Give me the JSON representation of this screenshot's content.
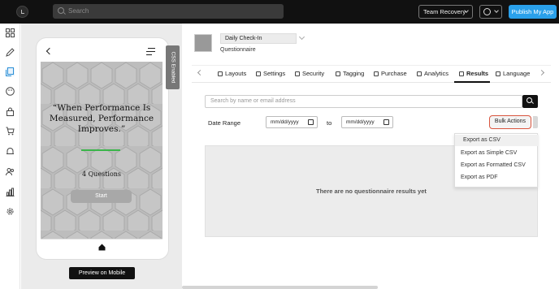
{
  "topbar": {
    "search_placeholder": "Search",
    "team_label": "Team Recovery",
    "publish_label": "Publish My App",
    "colors": {
      "bar": "#111111",
      "publish": "#2aa0ea"
    }
  },
  "leftnav": {
    "icons": [
      "grid-icon",
      "pencil-icon",
      "pages-icon",
      "palette-icon",
      "lock-icon",
      "cart-icon",
      "bell-icon",
      "users-icon",
      "chart-icon",
      "gear-icon"
    ],
    "active": "pages-icon"
  },
  "preview": {
    "css_tab_label": "CSS Enabled",
    "hero_title": "“When Performance Is Measured, Performance Improves.”",
    "question_count": "4 Questions",
    "start_label": "Start",
    "preview_button": "Preview on Mobile",
    "accent_line_color": "#3ab54a"
  },
  "header": {
    "app_name": "Daily Check-In",
    "app_type": "Questionnaire"
  },
  "tabs": {
    "items": [
      {
        "label": "Layouts",
        "icon": "layout-icon"
      },
      {
        "label": "Settings",
        "icon": "settings-icon"
      },
      {
        "label": "Security",
        "icon": "shield-icon"
      },
      {
        "label": "Tagging",
        "icon": "tag-icon"
      },
      {
        "label": "Purchase",
        "icon": "card-icon"
      },
      {
        "label": "Analytics",
        "icon": "analytics-icon"
      },
      {
        "label": "Results",
        "icon": "results-icon"
      },
      {
        "label": "Language",
        "icon": "language-icon"
      }
    ],
    "active": "Results"
  },
  "filters": {
    "search_placeholder": "Search by name or email address",
    "date_range_label": "Date Range",
    "date_from": "mm/dd/yyyy",
    "to_label": "to",
    "date_to": "mm/dd/yyyy",
    "bulk_label": "Bulk Actions",
    "bulk_highlight_color": "#d9553f"
  },
  "bulk_menu": {
    "items": [
      "Export as CSV",
      "Export as Simple CSV",
      "Export as Formatted CSV",
      "Export as PDF"
    ],
    "highlighted": "Export as CSV"
  },
  "results": {
    "empty_message": "There are no questionnaire results yet"
  }
}
